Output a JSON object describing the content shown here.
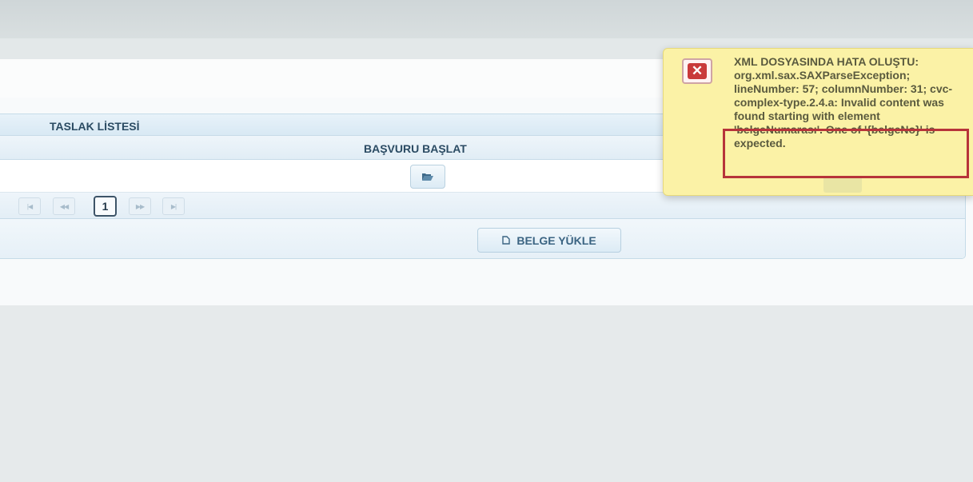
{
  "table": {
    "caption": "TASLAK LİSTESİ",
    "column_header": "BAŞVURU BAŞLAT",
    "rows": [
      {
        "action_icon": "folder-open-icon"
      }
    ]
  },
  "pager": {
    "first": "|◀",
    "prev": "◀◀",
    "current_page": "1",
    "next": "▶▶",
    "last": "▶|"
  },
  "footer": {
    "upload_icon": "document-icon",
    "upload_label": "BELGE YÜKLE"
  },
  "notification": {
    "type": "error",
    "icon": "error-x-icon",
    "message": "XML DOSYASINDA HATA OLUŞTU: org.xml.sax.SAXParseException; lineNumber: 57; columnNumber: 31; cvc-complex-type.2.4.a: Invalid content was found starting with element 'belgeNumarası'. One of '{belgeNo}' is expected."
  },
  "colors": {
    "highlight_border": "#b7343a",
    "toast_background": "#fbf2a6",
    "header_text": "#2b4b63"
  }
}
